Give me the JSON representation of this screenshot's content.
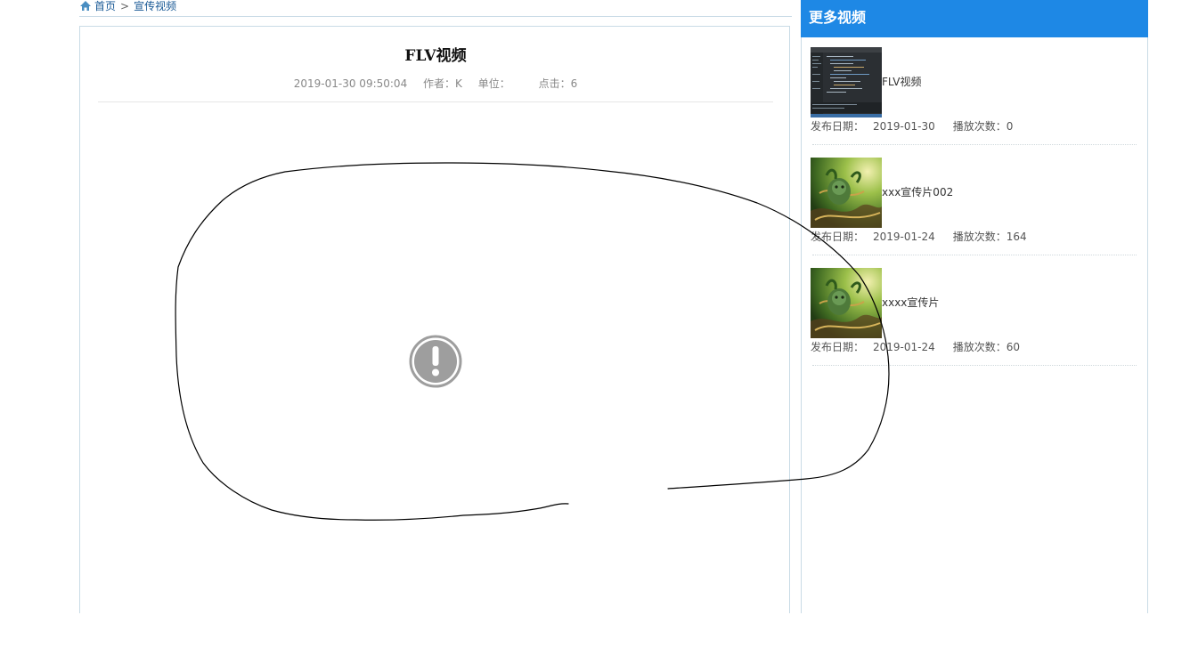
{
  "breadcrumb": {
    "home_label": "首页",
    "separator": ">",
    "current_label": "宣传视频"
  },
  "article": {
    "title": "FLV视频",
    "datetime": "2019-01-30 09:50:04",
    "author_label": "作者：",
    "author": "K",
    "unit_label": "单位：",
    "unit": "",
    "clicks_label": "点击：",
    "clicks": "6",
    "player_icon": "exclamation-circle-icon"
  },
  "sidebar": {
    "title": "更多视频",
    "items": [
      {
        "title": "FLV视频",
        "date_label": "发布日期：",
        "date": "2019-01-30",
        "plays_label": "播放次数：",
        "plays": "0",
        "thumb": "screen-thumbnail"
      },
      {
        "title": "xxx宣传片002",
        "date_label": "发布日期：",
        "date": "2019-01-24",
        "plays_label": "播放次数：",
        "plays": "164",
        "thumb": "plant-creature-thumbnail"
      },
      {
        "title": "xxxx宣传片",
        "date_label": "发布日期：",
        "date": "2019-01-24",
        "plays_label": "播放次数：",
        "plays": "60",
        "thumb": "plant-creature-thumbnail"
      }
    ]
  },
  "colors": {
    "sidebar_header_bg": "#1e88e5",
    "link": "#1a5a96",
    "border": "#c9dbe6"
  }
}
